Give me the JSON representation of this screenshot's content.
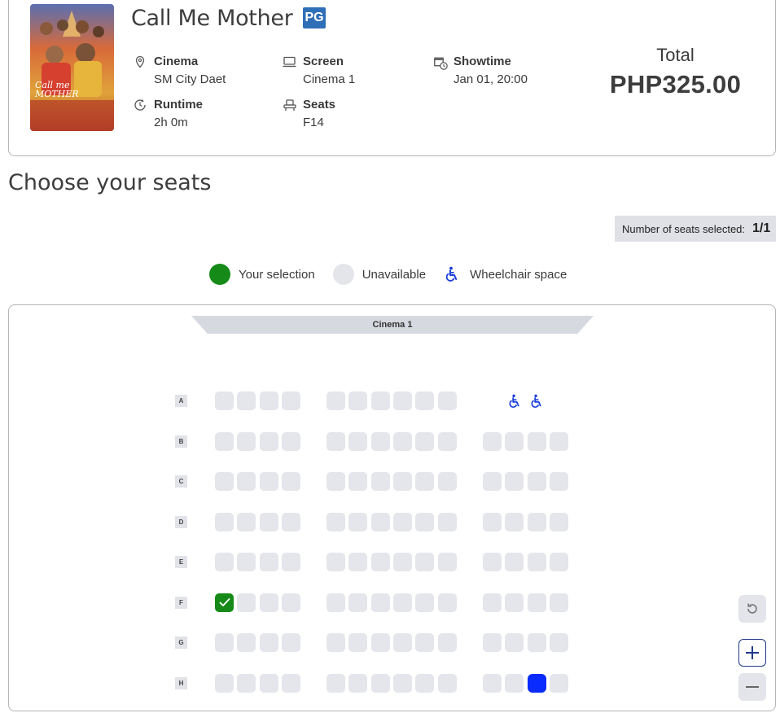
{
  "movie": {
    "title": "Call Me Mother",
    "rating": "PG",
    "poster_text": "Call me MOTHER"
  },
  "details": {
    "cinema": {
      "label": "Cinema",
      "value": "SM City Daet",
      "icon": "location-pin-icon"
    },
    "screen": {
      "label": "Screen",
      "value": "Cinema 1",
      "icon": "monitor-icon"
    },
    "showtime": {
      "label": "Showtime",
      "value": "Jan 01, 20:00",
      "icon": "calendar-clock-icon"
    },
    "runtime": {
      "label": "Runtime",
      "value": "2h 0m",
      "icon": "clock-icon"
    },
    "seats": {
      "label": "Seats",
      "value": "F14",
      "icon": "seat-icon"
    }
  },
  "total": {
    "label": "Total",
    "value": "PHP325.00"
  },
  "page": {
    "heading": "Choose your seats"
  },
  "counter": {
    "label": "Number of seats selected:",
    "value": "1/1"
  },
  "legend": {
    "selection": "Your selection",
    "unavailable": "Unavailable",
    "wheelchair": "Wheelchair space"
  },
  "colors": {
    "selected": "#168a18",
    "unavailable": "#e5e6eb",
    "wheelchair": "#1a3fd9",
    "rating_badge": "#2f6fb7"
  },
  "seatmap": {
    "screen_label": "Cinema 1",
    "rows": [
      {
        "label": "A",
        "left": [
          "u",
          "u",
          "u",
          "u"
        ],
        "center": [
          "u",
          "u",
          "u",
          "u",
          "u",
          "u"
        ],
        "right": [
          "",
          "w",
          "w",
          ""
        ]
      },
      {
        "label": "B",
        "left": [
          "u",
          "u",
          "u",
          "u"
        ],
        "center": [
          "u",
          "u",
          "u",
          "u",
          "u",
          "u"
        ],
        "right": [
          "u",
          "u",
          "u",
          "u"
        ]
      },
      {
        "label": "C",
        "left": [
          "u",
          "u",
          "u",
          "u"
        ],
        "center": [
          "u",
          "u",
          "u",
          "u",
          "u",
          "u"
        ],
        "right": [
          "u",
          "u",
          "u",
          "u"
        ]
      },
      {
        "label": "D",
        "left": [
          "u",
          "u",
          "u",
          "u"
        ],
        "center": [
          "u",
          "u",
          "u",
          "u",
          "u",
          "u"
        ],
        "right": [
          "u",
          "u",
          "u",
          "u"
        ]
      },
      {
        "label": "E",
        "left": [
          "u",
          "u",
          "u",
          "u"
        ],
        "center": [
          "u",
          "u",
          "u",
          "u",
          "u",
          "u"
        ],
        "right": [
          "u",
          "u",
          "u",
          "u"
        ]
      },
      {
        "label": "F",
        "left": [
          "s",
          "u",
          "u",
          "u"
        ],
        "center": [
          "u",
          "u",
          "u",
          "u",
          "u",
          "u"
        ],
        "right": [
          "u",
          "u",
          "u",
          "u"
        ]
      },
      {
        "label": "G",
        "left": [
          "u",
          "u",
          "u",
          "u"
        ],
        "center": [
          "u",
          "u",
          "u",
          "u",
          "u",
          "u"
        ],
        "right": [
          "u",
          "u",
          "u",
          "u"
        ]
      },
      {
        "label": "H",
        "left": [
          "u",
          "u",
          "u",
          "u"
        ],
        "center": [
          "u",
          "u",
          "u",
          "u",
          "u",
          "u"
        ],
        "right": [
          "u",
          "u",
          "b",
          "u"
        ]
      }
    ]
  },
  "controls": {
    "reset": "reset-icon",
    "zoom_in": "plus-icon",
    "zoom_out": "minus-icon"
  }
}
